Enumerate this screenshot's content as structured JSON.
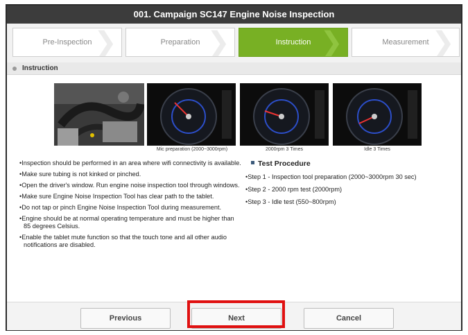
{
  "window": {
    "title": "001. Campaign SC147 Engine Noise Inspection"
  },
  "steps": [
    {
      "label": "Pre-Inspection",
      "active": false
    },
    {
      "label": "Preparation",
      "active": false
    },
    {
      "label": "Instruction",
      "active": true
    },
    {
      "label": "Measurement",
      "active": false
    }
  ],
  "section": {
    "title": "Instruction"
  },
  "images": {
    "captions": [
      "Mic preparation (2000~3000rpm)",
      "2000rpm 3 Times",
      "Idle 3 Times"
    ]
  },
  "instructions": [
    "Inspection should be performed in an area where wifi connectivity is available.",
    "Make sure tubing is not kinked or pinched.",
    "Open the driver's window. Run engine noise inspection tool through windows.",
    "Make sure Engine Noise Inspection Tool has clear path to the tablet.",
    "Do not tap or pinch Engine Noise Inspection Tool during measurement.",
    "Engine should be at normal operating temperature and must be higher than 85 degrees Celsius.",
    "Enable the tablet mute function so that the touch tone and all other audio notifications are disabled."
  ],
  "test_procedure": {
    "title": "Test Procedure",
    "steps": [
      "Step 1 - Inspection tool preparation (2000~3000rpm 30 sec)",
      "Step 2 - 2000 rpm test (2000rpm)",
      "Step 3 - Idle test (550~800rpm)"
    ]
  },
  "footer": {
    "previous": "Previous",
    "next": "Next",
    "cancel": "Cancel"
  },
  "colors": {
    "active_step": "#78b024",
    "title_bar": "#3c3c3c",
    "highlight": "#e01010"
  }
}
